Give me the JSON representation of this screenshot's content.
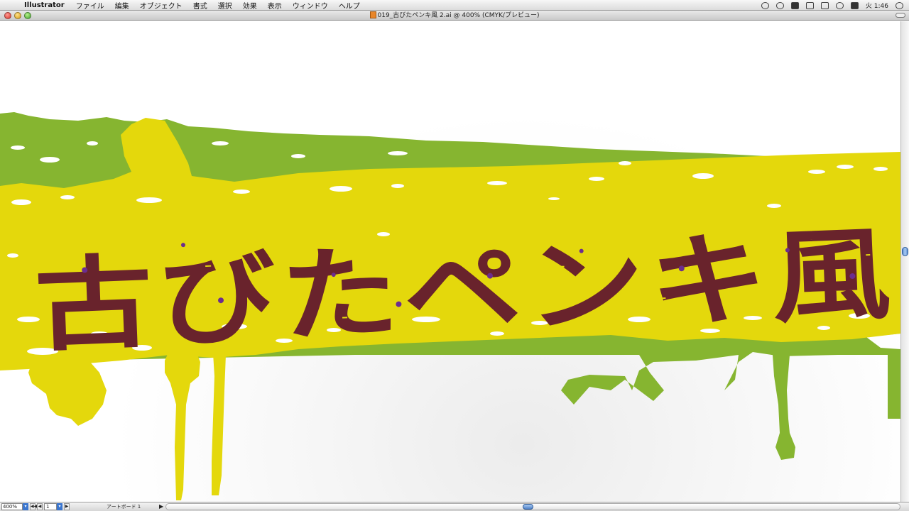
{
  "menubar": {
    "apple_glyph": "",
    "app_name": "Illustrator",
    "items": [
      "ファイル",
      "編集",
      "オブジェクト",
      "書式",
      "選択",
      "効果",
      "表示",
      "ウィンドウ",
      "ヘルプ"
    ],
    "clock": "火 1:46",
    "status_icons": [
      "sync-icon",
      "time-machine-icon",
      "display-icon",
      "bluetooth-icon",
      "volume-icon",
      "wifi-icon",
      "input-menu-icon",
      "spotlight-icon"
    ]
  },
  "window": {
    "title": "019_古びたペンキ風 2.ai @ 400% (CMYK/プレビュー)",
    "doc_icon": "ai-document-icon"
  },
  "artwork": {
    "text": "古びたペンキ風",
    "colors": {
      "paint_yellow": "#e4d80c",
      "paint_green": "#86b530",
      "text_maroon": "#69232c",
      "speckle_purple": "#6b2d8f"
    }
  },
  "bottombar": {
    "zoom": "400%",
    "page": "1",
    "artboard_label": "アートボード 1",
    "first_glyph": "◀◀",
    "prev_glyph": "◀",
    "next_glyph": "▶",
    "play_glyph": "▶"
  }
}
